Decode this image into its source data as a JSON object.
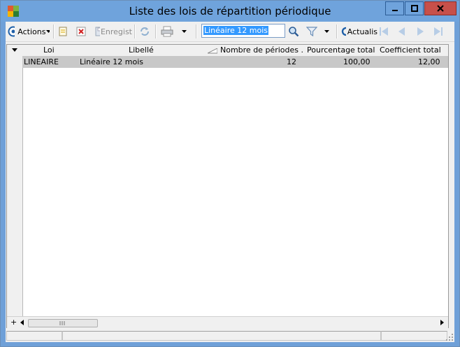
{
  "window": {
    "title": "Liste des lois de répartition périodique"
  },
  "toolbar": {
    "actions_label": "Actions",
    "save_label": "Enregist",
    "search_value": "Linéaire 12 mois",
    "refresh_label": "Actualis"
  },
  "grid": {
    "columns": [
      "Loi",
      "Libellé",
      "Nombre de périodes ...",
      "Pourcentage total",
      "Coefficient total"
    ],
    "rows": [
      {
        "loi": "LINEAIRE",
        "libelle": "Linéaire 12 mois",
        "nombre": "12",
        "pourcentage": "100,00",
        "coefficient": "12,00"
      }
    ]
  },
  "colors": {
    "titlebar": "#6fa3dc",
    "close": "#c7504a",
    "selection": "#c8c8c8",
    "highlight": "#3399ff"
  }
}
